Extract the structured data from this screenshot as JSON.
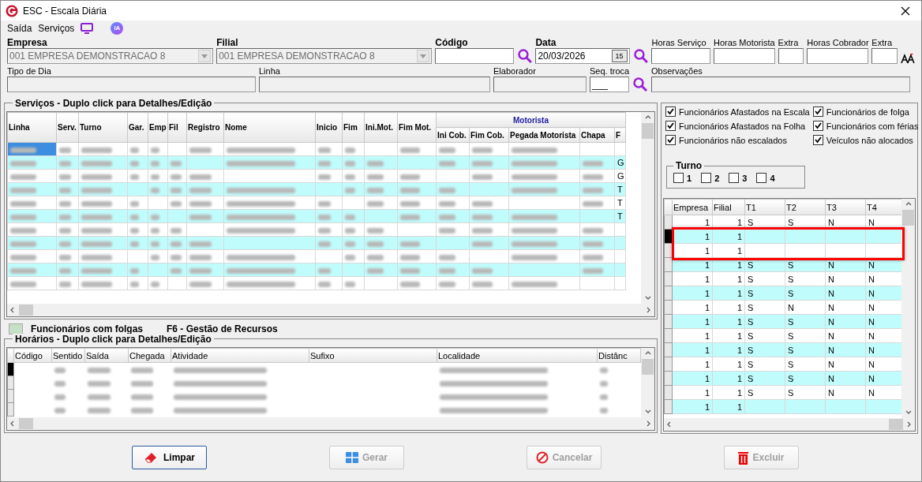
{
  "window": {
    "title": "ESC - Escala Diária"
  },
  "menu": [
    {
      "label": "Saída",
      "kind": "text"
    },
    {
      "label": "Serviços",
      "kind": "text"
    },
    {
      "kind": "monitor"
    },
    {
      "label": "IA",
      "kind": "badge"
    }
  ],
  "form": {
    "empresa": {
      "label": "Empresa",
      "value": "001 EMPRESA DEMONSTRACAO 8"
    },
    "filial": {
      "label": "Filial",
      "value": "001 EMPRESA DEMONSTRACAO 8"
    },
    "codigo": {
      "label": "Código"
    },
    "data": {
      "label": "Data",
      "value": "20/03/2026",
      "calendar": "15"
    },
    "horas": [
      {
        "label": "Horas Serviço"
      },
      {
        "label": "Horas Motorista"
      },
      {
        "label": "Extra"
      },
      {
        "label": "Horas Cobrador"
      },
      {
        "label": "Extra"
      }
    ],
    "tipo_dia": {
      "label": "Tipo de Dia"
    },
    "linha": {
      "label": "Linha"
    },
    "elaborador": {
      "label": "Elaborador"
    },
    "seq_troca": {
      "label": "Seq. troca",
      "value": "___"
    },
    "observacoes": {
      "label": "Observações"
    }
  },
  "servicos": {
    "title": "Serviços  - Duplo click para Detalhes/Edição",
    "group_header": "Motorista",
    "columns": [
      "Linha",
      "Serv.",
      "Turno",
      "Gar.",
      "Emp",
      "Fil",
      "Registro",
      "Nome",
      "Inicio",
      "Fim",
      "Ini.Mot.",
      "Fim Mot.",
      "Ini Cob.",
      "Fim Cob.",
      "Pegada Motorista",
      "Chapa",
      "F"
    ],
    "rows": [
      {
        "tinted": false,
        "selected": true,
        "column_17": ""
      },
      {
        "tinted": true,
        "selected": false,
        "column_17": "G"
      },
      {
        "tinted": false,
        "selected": false,
        "column_17": "G"
      },
      {
        "tinted": true,
        "selected": false,
        "column_17": "T"
      },
      {
        "tinted": false,
        "selected": false,
        "column_17": "T"
      },
      {
        "tinted": true,
        "selected": false,
        "column_17": "T"
      },
      {
        "tinted": false,
        "selected": false,
        "column_17": ""
      },
      {
        "tinted": true,
        "selected": false,
        "column_17": ""
      },
      {
        "tinted": false,
        "selected": false,
        "column_17": ""
      },
      {
        "tinted": true,
        "selected": false,
        "column_17": ""
      },
      {
        "tinted": false,
        "selected": false,
        "column_17": ""
      }
    ]
  },
  "legend": [
    {
      "label": "Funcionários com folgas",
      "color": "#c6e0c6"
    },
    {
      "label": "F6 - Gestão de Recursos"
    }
  ],
  "horarios": {
    "title": "Horários  - Duplo click para Detalhes/Edição",
    "columns": [
      "Código",
      "Sentido",
      "Saída",
      "Chegada",
      "Atividade",
      "Sufixo",
      "Localidade",
      "Distânc"
    ],
    "rows": [
      {
        "current": true
      },
      {
        "current": false
      },
      {
        "current": false
      },
      {
        "current": false
      }
    ]
  },
  "filters": [
    {
      "label": "Funcionários Afastados na Escala",
      "checked": true
    },
    {
      "label": "Funcionários de folga",
      "checked": true
    },
    {
      "label": "Funcionários Afastados na Folha",
      "checked": true
    },
    {
      "label": "Funcionários com férias",
      "checked": true
    },
    {
      "label": "Funcionários não escalados",
      "checked": true
    },
    {
      "label": "Veículos não alocados",
      "checked": true
    }
  ],
  "turno": {
    "title": "Turno",
    "options": [
      {
        "label": "1",
        "checked": false
      },
      {
        "label": "2",
        "checked": false
      },
      {
        "label": "3",
        "checked": false
      },
      {
        "label": "4",
        "checked": false
      }
    ]
  },
  "turnos_grid": {
    "columns": [
      "Empresa",
      "Filial",
      "T1",
      "T2",
      "T3",
      "T4"
    ],
    "rows": [
      {
        "cells": [
          "1",
          "1",
          "S",
          "S",
          "N",
          "N"
        ],
        "current": false,
        "highlighted": false
      },
      {
        "cells": [
          "1",
          "1",
          "",
          "",
          "",
          ""
        ],
        "current": true,
        "highlighted": true
      },
      {
        "cells": [
          "1",
          "1",
          "",
          "",
          "",
          ""
        ],
        "current": false,
        "highlighted": true
      },
      {
        "cells": [
          "1",
          "1",
          "S",
          "S",
          "N",
          "N"
        ],
        "current": false,
        "highlighted": false
      },
      {
        "cells": [
          "1",
          "1",
          "S",
          "S",
          "N",
          "N"
        ],
        "current": false,
        "highlighted": false
      },
      {
        "cells": [
          "1",
          "1",
          "S",
          "S",
          "N",
          "N"
        ],
        "current": false,
        "highlighted": false
      },
      {
        "cells": [
          "1",
          "1",
          "S",
          "N",
          "N",
          "N"
        ],
        "current": false,
        "highlighted": false
      },
      {
        "cells": [
          "1",
          "1",
          "S",
          "S",
          "N",
          "N"
        ],
        "current": false,
        "highlighted": false
      },
      {
        "cells": [
          "1",
          "1",
          "S",
          "S",
          "N",
          "N"
        ],
        "current": false,
        "highlighted": false
      },
      {
        "cells": [
          "1",
          "1",
          "S",
          "S",
          "N",
          "N"
        ],
        "current": false,
        "highlighted": false
      },
      {
        "cells": [
          "1",
          "1",
          "S",
          "S",
          "N",
          "N"
        ],
        "current": false,
        "highlighted": false
      },
      {
        "cells": [
          "1",
          "1",
          "S",
          "S",
          "N",
          "N"
        ],
        "current": false,
        "highlighted": false
      },
      {
        "cells": [
          "1",
          "1",
          "S",
          "S",
          "N",
          "N"
        ],
        "current": false,
        "highlighted": false
      },
      {
        "cells": [
          "1",
          "1",
          "",
          "",
          "",
          ""
        ],
        "current": false,
        "highlighted": false
      }
    ]
  },
  "buttons": [
    {
      "label": "Limpar",
      "kind": "eraser",
      "disabled": false
    },
    {
      "label": "Gerar",
      "kind": "grid",
      "disabled": true
    },
    {
      "label": "Cancelar",
      "kind": "cancel",
      "disabled": true
    },
    {
      "label": "Excluir",
      "kind": "trash",
      "disabled": true
    }
  ]
}
